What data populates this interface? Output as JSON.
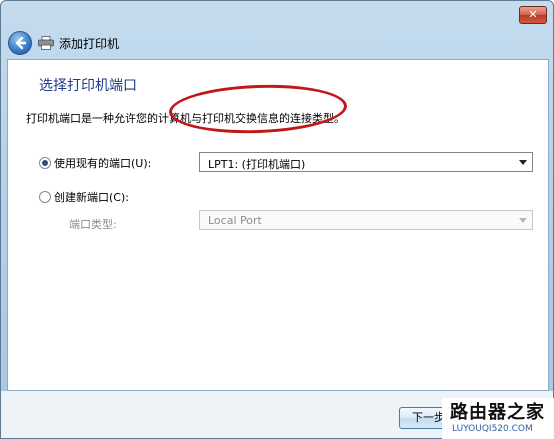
{
  "window": {
    "close_glyph": "✕",
    "nav_title": "添加打印机",
    "icons": {
      "back": "back-arrow-icon",
      "printer": "printer-icon"
    }
  },
  "page": {
    "heading": "选择打印机端口",
    "description": "打印机端口是一种允许您的计算机与打印机交换信息的连接类型。"
  },
  "options": {
    "existing_label": "使用现有的端口(U):",
    "existing_selected": true,
    "existing_value": "LPT1: (打印机端口)",
    "new_label": "创建新端口(C):",
    "new_selected": false,
    "port_type_label": "端口类型:",
    "port_type_value": "Local Port"
  },
  "footer": {
    "next_label": "下一步(N"
  },
  "watermark": {
    "title": "路由器之家",
    "url": "LUYOUQI520.COM"
  },
  "colors": {
    "heading": "#1e3b8a",
    "annotation": "#c01818"
  }
}
